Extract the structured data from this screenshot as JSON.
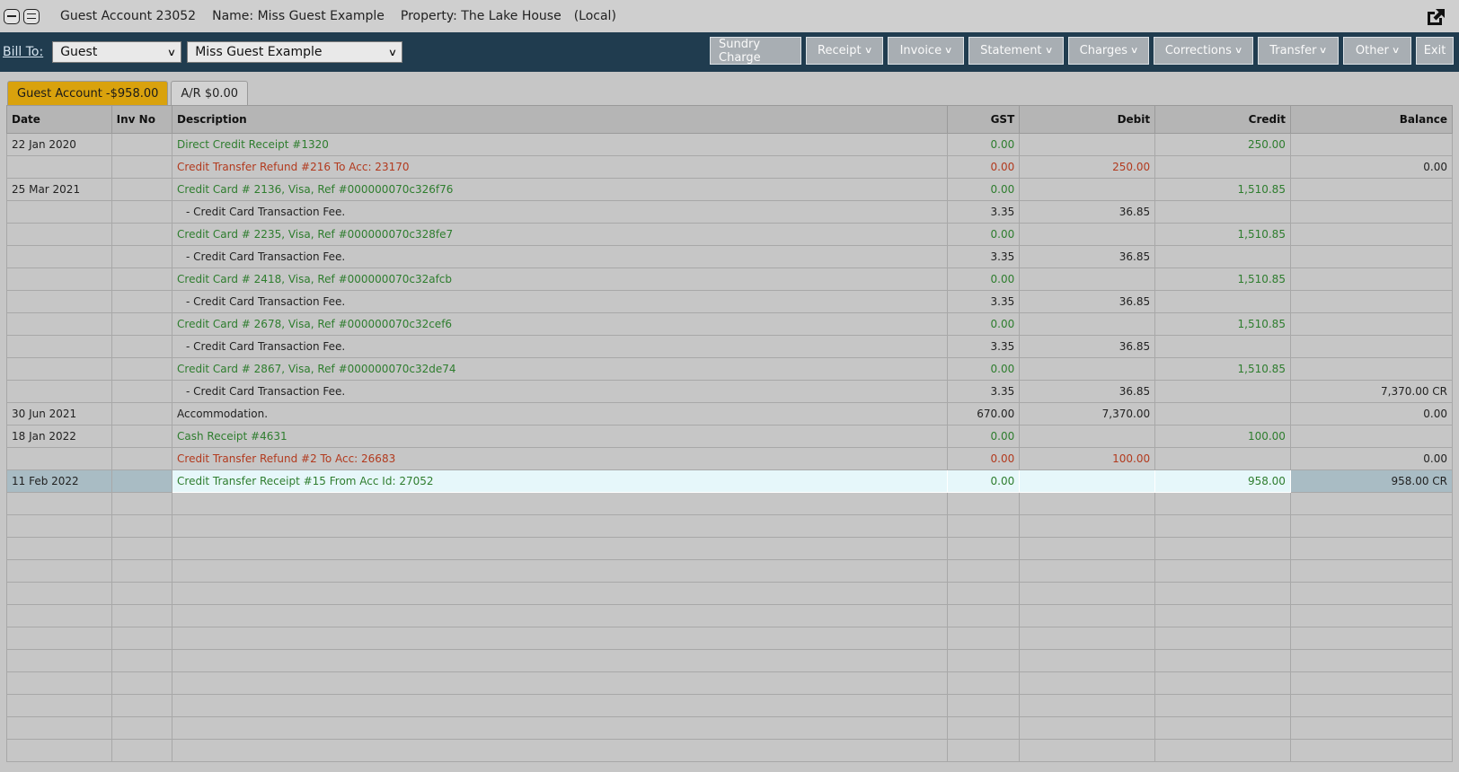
{
  "window": {
    "account_title": "Guest Account 23052",
    "name_label": "Name: Miss Guest Example",
    "property_label": "Property: The Lake House",
    "location_label": "(Local)"
  },
  "toolbar": {
    "bill_to_label": "Bill To:",
    "bill_to_type": "Guest",
    "bill_to_name": "Miss Guest Example",
    "buttons": [
      "Sundry Charge",
      "Receipt",
      "Invoice",
      "Statement",
      "Charges",
      "Corrections",
      "Transfer",
      "Other",
      "Exit"
    ]
  },
  "tabs": [
    {
      "label": "Guest Account -$958.00",
      "active": true
    },
    {
      "label": "A/R $0.00",
      "active": false
    }
  ],
  "table": {
    "columns": [
      "Date",
      "Inv No",
      "Description",
      "GST",
      "Debit",
      "Credit",
      "Balance"
    ],
    "rows": [
      {
        "date": "22 Jan 2020",
        "inv": "",
        "desc": "Direct Credit Receipt #1320",
        "gst": "0.00",
        "debit": "",
        "credit": "250.00",
        "balance": "",
        "style": "green"
      },
      {
        "date": "",
        "inv": "",
        "desc": "Credit Transfer Refund #216 To Acc: 23170",
        "gst": "0.00",
        "debit": "250.00",
        "credit": "",
        "balance": "0.00",
        "style": "red"
      },
      {
        "date": "25 Mar 2021",
        "inv": "",
        "desc": "Credit Card # 2136, Visa, Ref #000000070c326f76",
        "gst": "0.00",
        "debit": "",
        "credit": "1,510.85",
        "balance": "",
        "style": "green"
      },
      {
        "date": "",
        "inv": "",
        "desc": "- Credit Card Transaction Fee.",
        "gst": "3.35",
        "debit": "36.85",
        "credit": "",
        "balance": "",
        "style": "fee"
      },
      {
        "date": "",
        "inv": "",
        "desc": "Credit Card # 2235, Visa, Ref #000000070c328fe7",
        "gst": "0.00",
        "debit": "",
        "credit": "1,510.85",
        "balance": "",
        "style": "green"
      },
      {
        "date": "",
        "inv": "",
        "desc": "- Credit Card Transaction Fee.",
        "gst": "3.35",
        "debit": "36.85",
        "credit": "",
        "balance": "",
        "style": "fee"
      },
      {
        "date": "",
        "inv": "",
        "desc": "Credit Card # 2418, Visa, Ref #000000070c32afcb",
        "gst": "0.00",
        "debit": "",
        "credit": "1,510.85",
        "balance": "",
        "style": "green"
      },
      {
        "date": "",
        "inv": "",
        "desc": "- Credit Card Transaction Fee.",
        "gst": "3.35",
        "debit": "36.85",
        "credit": "",
        "balance": "",
        "style": "fee"
      },
      {
        "date": "",
        "inv": "",
        "desc": "Credit Card # 2678, Visa, Ref #000000070c32cef6",
        "gst": "0.00",
        "debit": "",
        "credit": "1,510.85",
        "balance": "",
        "style": "green"
      },
      {
        "date": "",
        "inv": "",
        "desc": "- Credit Card Transaction Fee.",
        "gst": "3.35",
        "debit": "36.85",
        "credit": "",
        "balance": "",
        "style": "fee"
      },
      {
        "date": "",
        "inv": "",
        "desc": "Credit Card # 2867, Visa, Ref #000000070c32de74",
        "gst": "0.00",
        "debit": "",
        "credit": "1,510.85",
        "balance": "",
        "style": "green"
      },
      {
        "date": "",
        "inv": "",
        "desc": "- Credit Card Transaction Fee.",
        "gst": "3.35",
        "debit": "36.85",
        "credit": "",
        "balance": "7,370.00 CR",
        "style": "fee"
      },
      {
        "date": "30 Jun 2021",
        "inv": "",
        "desc": "Accommodation.",
        "gst": "670.00",
        "debit": "7,370.00",
        "credit": "",
        "balance": "0.00",
        "style": "plain"
      },
      {
        "date": "18 Jan 2022",
        "inv": "",
        "desc": "Cash Receipt #4631",
        "gst": "0.00",
        "debit": "",
        "credit": "100.00",
        "balance": "",
        "style": "green"
      },
      {
        "date": "",
        "inv": "",
        "desc": "Credit Transfer Refund #2 To Acc: 26683",
        "gst": "0.00",
        "debit": "100.00",
        "credit": "",
        "balance": "0.00",
        "style": "red"
      },
      {
        "date": "11 Feb 2022",
        "inv": "",
        "desc": "Credit Transfer Receipt #15 From Acc Id: 27052",
        "gst": "0.00",
        "debit": "",
        "credit": "958.00",
        "balance": "958.00 CR",
        "style": "green",
        "selected": true
      }
    ],
    "empty_rows": 12
  },
  "colors": {
    "toolbar_bg": "#203c4f",
    "active_tab": "#d9a20d",
    "credit_text": "#2e7d2e",
    "debit_text": "#b23a1e"
  },
  "icons": [
    "minimize-icon",
    "menu-icon",
    "popout-icon",
    "chevron-down-icon"
  ]
}
